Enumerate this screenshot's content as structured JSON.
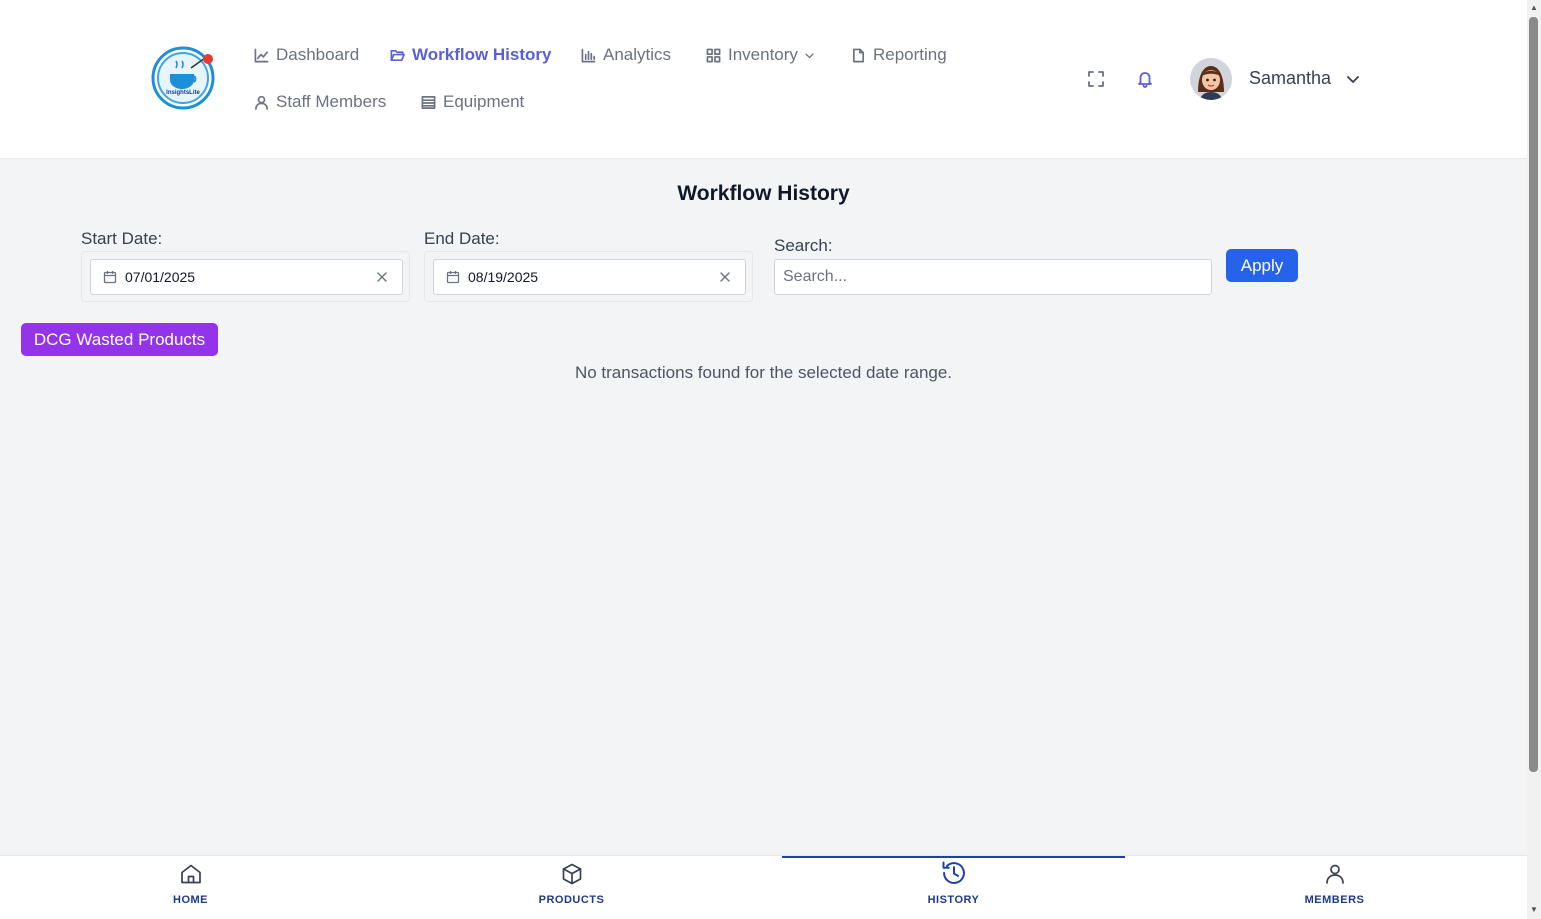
{
  "header": {
    "logo_text": "InsightsLite",
    "nav": [
      {
        "label": "Dashboard",
        "icon": "line-chart-icon",
        "active": false
      },
      {
        "label": "Workflow History",
        "icon": "folder-open-icon",
        "active": true
      },
      {
        "label": "Analytics",
        "icon": "bar-chart-icon",
        "active": false
      },
      {
        "label": "Inventory",
        "icon": "grid-icon",
        "active": false,
        "has_dropdown": true
      },
      {
        "label": "Reporting",
        "icon": "file-icon",
        "active": false
      },
      {
        "label": "Staff Members",
        "icon": "user-icon",
        "active": false
      },
      {
        "label": "Equipment",
        "icon": "list-icon",
        "active": false
      }
    ],
    "user": {
      "name": "Samantha"
    }
  },
  "main": {
    "title": "Workflow History",
    "start_date": {
      "label": "Start Date:",
      "value": "07/01/2025"
    },
    "end_date": {
      "label": "End Date:",
      "value": "08/19/2025"
    },
    "search": {
      "label": "Search:",
      "placeholder": "Search..."
    },
    "apply_label": "Apply",
    "wasted_products_label": "DCG Wasted Products",
    "empty_message": "No transactions found for the selected date range."
  },
  "bottom_nav": [
    {
      "label": "HOME",
      "icon": "home-icon",
      "active": false
    },
    {
      "label": "PRODUCTS",
      "icon": "box-icon",
      "active": false
    },
    {
      "label": "HISTORY",
      "icon": "history-icon",
      "active": true
    },
    {
      "label": "MEMBERS",
      "icon": "user-icon",
      "active": false
    }
  ],
  "colors": {
    "accent": "#5b5fd6",
    "apply": "#2563eb",
    "wasted": "#9333ea",
    "bottom_active": "#1e40af"
  }
}
